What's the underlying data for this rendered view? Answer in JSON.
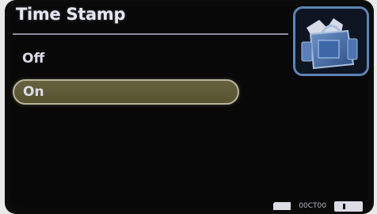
{
  "screen": {
    "title": "Time Stamp",
    "category_icon": "camera-bag-icon"
  },
  "menu": {
    "options": [
      {
        "label": "Off",
        "selected": false
      },
      {
        "label": "On",
        "selected": true
      }
    ],
    "highlight_color": "#5f5a38"
  },
  "status": {
    "storage_icon": "memory-card-icon",
    "count": "00CT00",
    "battery_icon": "battery-icon"
  }
}
